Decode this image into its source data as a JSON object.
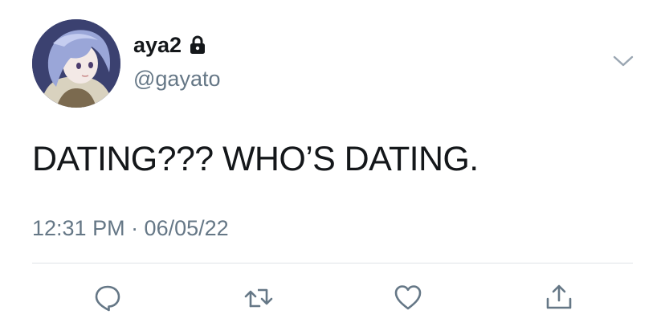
{
  "author": {
    "display_name": "aya2",
    "handle": "@gayato",
    "protected": true,
    "avatar": "anime-character-avatar"
  },
  "tweet": {
    "text": "DATING??? WHO’S DATING.",
    "timestamp": "12:31 PM · 06/05/22"
  },
  "actions": [
    "reply-icon",
    "retweet-icon",
    "like-icon",
    "share-icon"
  ],
  "colors": {
    "text": "#14171a",
    "secondary": "#657786",
    "divider": "#dfe3e7",
    "icon": "#657786"
  }
}
